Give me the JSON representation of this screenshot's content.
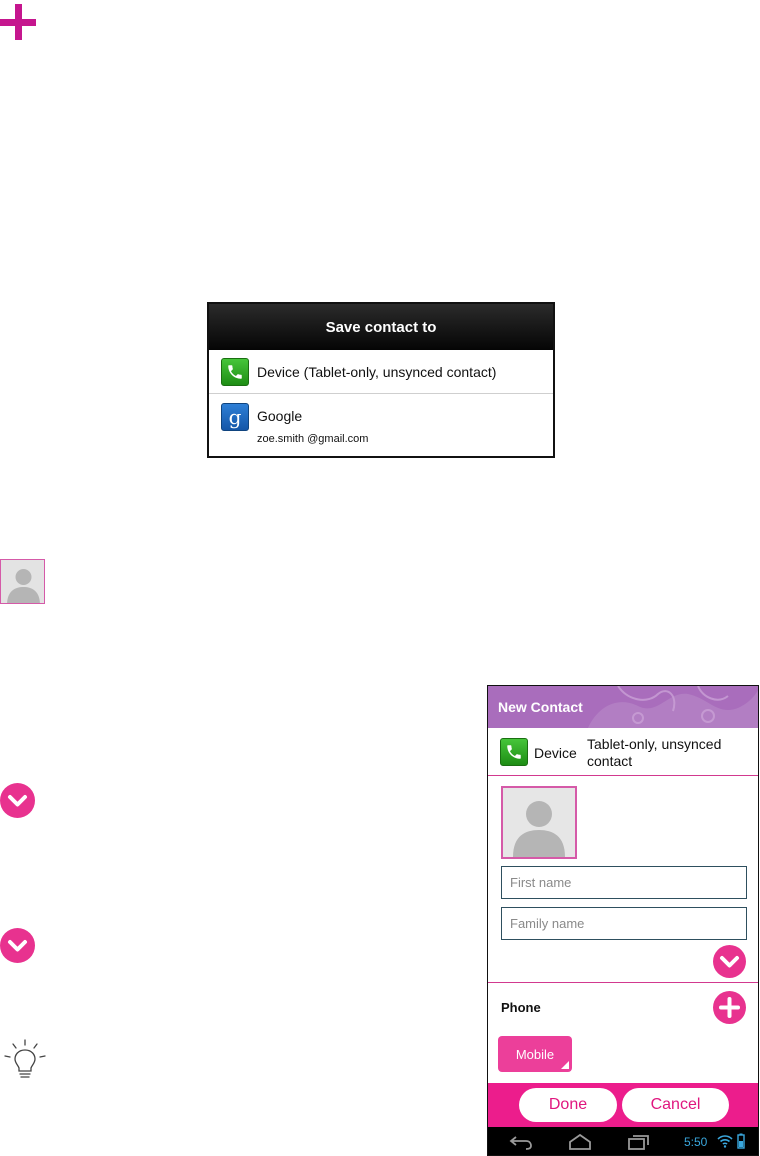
{
  "dialog": {
    "title": "Save contact to",
    "options": [
      {
        "label": "Device (Tablet-only, unsynced contact)",
        "icon": "phone-icon"
      },
      {
        "label": "Google",
        "sub": "zoe.smith @gmail.com",
        "icon": "google-icon"
      }
    ]
  },
  "phone_screen": {
    "title": "New Contact",
    "account": {
      "name": "Device",
      "desc": "Tablet-only, unsynced contact"
    },
    "first_name_placeholder": "First name",
    "family_name_placeholder": "Family name",
    "phone_label": "Phone",
    "phone_type": "Mobile",
    "done_label": "Done",
    "cancel_label": "Cancel",
    "time": "5:50"
  },
  "colors": {
    "accent_pink": "#e8328f",
    "header_purple": "#a96dbc",
    "plus_magenta": "#c5168e"
  }
}
